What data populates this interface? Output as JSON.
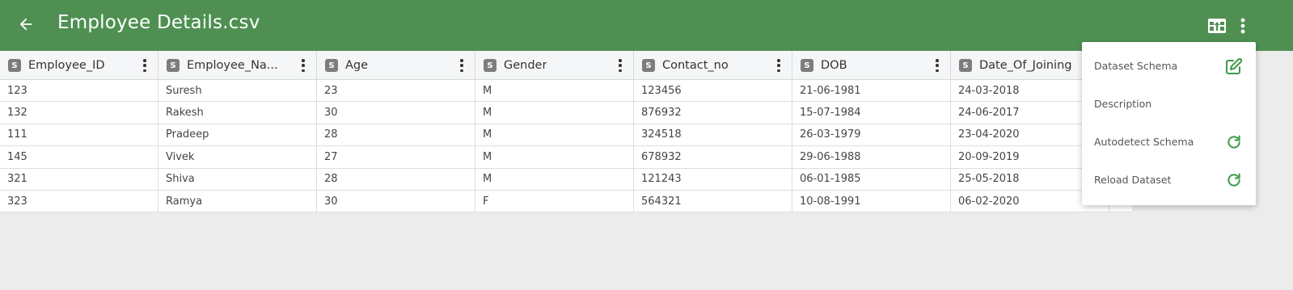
{
  "app": {
    "title": "Employee Details.csv",
    "accent_color": "#4f9052",
    "icons": {
      "back": "arrow-left-icon",
      "upload": "table-upload-icon",
      "more": "more-vert-icon"
    }
  },
  "table": {
    "type_badge": "S",
    "columns": [
      "Employee_ID",
      "Employee_Name",
      "Age",
      "Gender",
      "Contact_no",
      "DOB",
      "Date_Of_Joining"
    ],
    "columns_display": [
      "Employee_ID",
      "Employee_Na...",
      "Age",
      "Gender",
      "Contact_no",
      "DOB",
      "Date_Of_Joining"
    ],
    "rows": [
      [
        "123",
        "Suresh",
        "23",
        "M",
        "123456",
        "21-06-1981",
        "24-03-2018"
      ],
      [
        "132",
        "Rakesh",
        "30",
        "M",
        "876932",
        "15-07-1984",
        "24-06-2017"
      ],
      [
        "111",
        "Pradeep",
        "28",
        "M",
        "324518",
        "26-03-1979",
        "23-04-2020"
      ],
      [
        "145",
        "Vivek",
        "27",
        "M",
        "678932",
        "29-06-1988",
        "20-09-2019"
      ],
      [
        "321",
        "Shiva",
        "28",
        "M",
        "121243",
        "06-01-1985",
        "25-05-2018"
      ],
      [
        "323",
        "Ramya",
        "30",
        "F",
        "564321",
        "10-08-1991",
        "06-02-2020"
      ]
    ]
  },
  "menu": {
    "items": [
      {
        "label": "Dataset Schema",
        "icon": "edit-icon"
      },
      {
        "label": "Description",
        "icon": ""
      },
      {
        "label": "Autodetect Schema",
        "icon": "refresh-icon"
      },
      {
        "label": "Reload Dataset",
        "icon": "refresh-icon"
      }
    ],
    "icon_color": "#3e9a4a"
  }
}
